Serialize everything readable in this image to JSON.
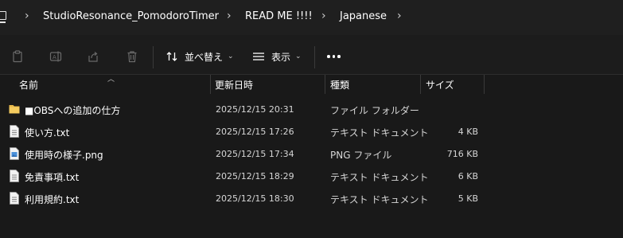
{
  "breadcrumb": {
    "items": [
      "StudioResonance_PomodoroTimer",
      "READ ME !!!!",
      "Japanese"
    ]
  },
  "toolbar": {
    "sort_label": "並べ替え",
    "view_label": "表示"
  },
  "columns": {
    "name": "名前",
    "date": "更新日時",
    "type": "種類",
    "size": "サイズ"
  },
  "files": [
    {
      "name": "■OBSへの追加の仕方",
      "date": "2025/12/15 20:31",
      "type": "ファイル フォルダー",
      "size": "",
      "icon": "folder-icon"
    },
    {
      "name": "使い方.txt",
      "date": "2025/12/15 17:26",
      "type": "テキスト ドキュメント",
      "size": "4 KB",
      "icon": "text-file-icon"
    },
    {
      "name": "使用時の様子.png",
      "date": "2025/12/15 17:34",
      "type": "PNG ファイル",
      "size": "716 KB",
      "icon": "image-file-icon"
    },
    {
      "name": "免責事項.txt",
      "date": "2025/12/15 18:29",
      "type": "テキスト ドキュメント",
      "size": "6 KB",
      "icon": "text-file-icon"
    },
    {
      "name": "利用規約.txt",
      "date": "2025/12/15 18:30",
      "type": "テキスト ドキュメント",
      "size": "5 KB",
      "icon": "text-file-icon"
    }
  ],
  "colors": {
    "background": "#191919",
    "folder": "#e8b84a",
    "image_accent": "#4a90d9"
  }
}
